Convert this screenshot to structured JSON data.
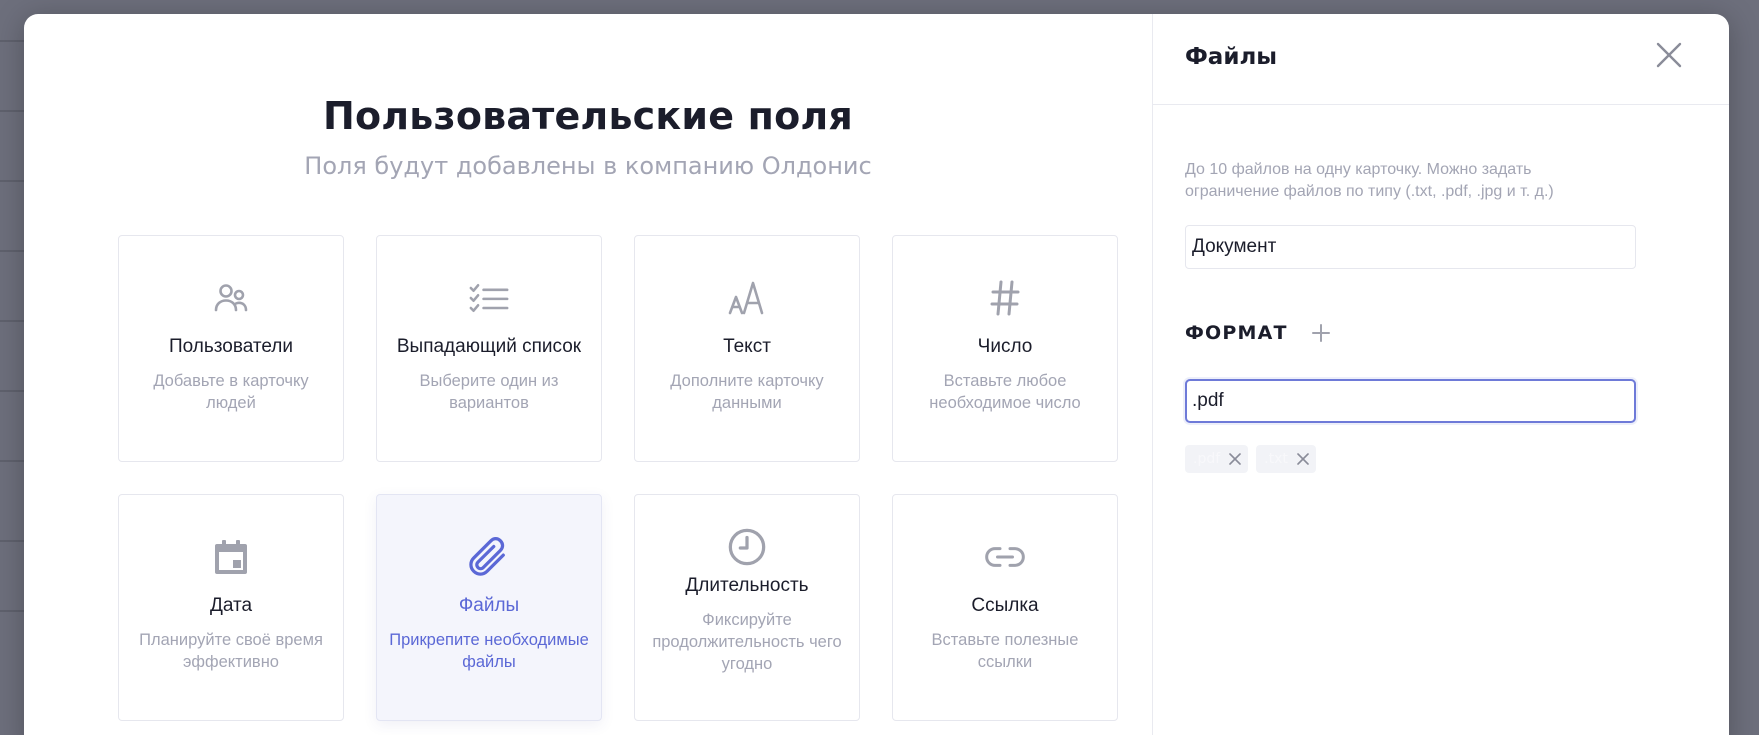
{
  "main": {
    "title": "Пользовательские поля",
    "subtitle": "Поля будут добавлены в компанию Олдонис"
  },
  "cards": [
    {
      "title": "Пользователи",
      "description": "Добавьте в карточку людей",
      "icon": "users-icon"
    },
    {
      "title": "Выпадающий список",
      "description": "Выберите один из вариантов",
      "icon": "checklist-icon"
    },
    {
      "title": "Текст",
      "description": "Дополните карточку данными",
      "icon": "text-size-icon"
    },
    {
      "title": "Число",
      "description": "Вставьте любое необходимое число",
      "icon": "hash-icon"
    },
    {
      "title": "Дата",
      "description": "Планируйте своё время эффективно",
      "icon": "calendar-icon"
    },
    {
      "title": "Файлы",
      "description": "Прикрепите необходимые файлы",
      "icon": "paperclip-icon",
      "active": true
    },
    {
      "title": "Длительность",
      "description": "Фиксируйте продолжительность чего угодно",
      "icon": "clock-icon"
    },
    {
      "title": "Ссылка",
      "description": "Вставьте полезные ссылки",
      "icon": "link-icon"
    }
  ],
  "panel": {
    "title": "Файлы",
    "hint": "До 10 файлов на одну карточку. Можно задать ограничение файлов по типу (.txt, .pdf, .jpg и т. д.)",
    "name_value": "Документ",
    "format_label": "ФОРМАТ",
    "format_value": ".pdf",
    "tags": [
      ".pdf",
      ".txt"
    ]
  },
  "colors": {
    "accent": "#5b68d6",
    "muted": "#a3a5b4",
    "text": "#1b1d2b",
    "icon_gray": "#a0a2ad"
  }
}
